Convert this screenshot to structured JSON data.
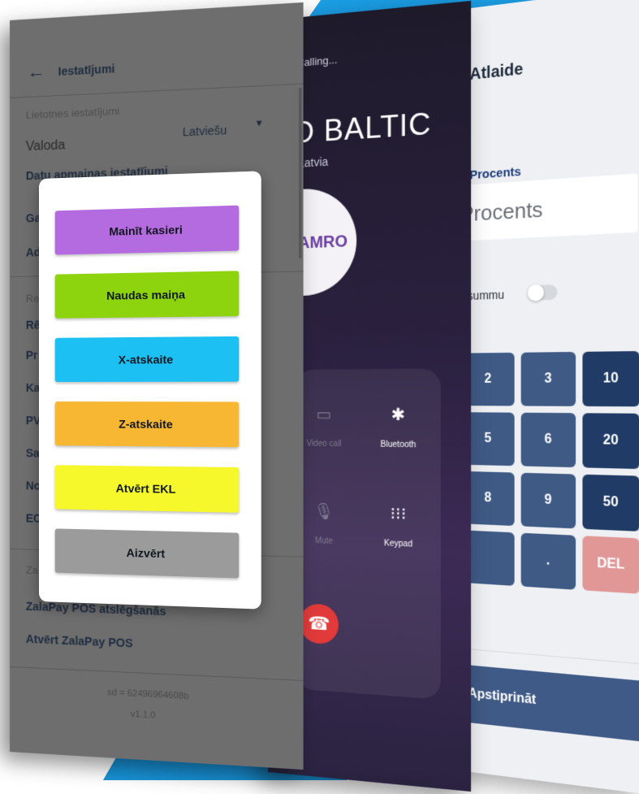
{
  "colors": {
    "accent_blue": "#1aa0e8",
    "btn_purple": "#b56be0",
    "btn_green": "#8ed40e",
    "btn_cyan": "#1cc0f2",
    "btn_orange": "#f8b733",
    "btn_yellow": "#f6f82b",
    "btn_gray": "#9b9b9b"
  },
  "settings": {
    "title": "Iestatījumi",
    "section_app": "Lietotnes iestatījumi",
    "language_label": "Valoda",
    "language_value": "Latviešu",
    "data_exchange": "Datu apmaiņas iestatījumi",
    "partial_items": [
      "Ga",
      "Ad",
      "Re",
      "Rē",
      "Pr",
      "Ka",
      "PV",
      "Sa",
      "No",
      "EC",
      "Za"
    ],
    "zalapay_disconnect": "ZalaPay POS atslēgšanās",
    "zalapay_open": "Atvērt ZalaPay POS",
    "sd": "sd = 62496964608b",
    "version": "v1.1.0"
  },
  "modal": {
    "buttons": [
      "Mainīt kasieri",
      "Naudas maiņa",
      "X-atskaite",
      "Z-atskaite",
      "Atvērt EKL",
      "Aizvērt"
    ]
  },
  "call": {
    "status": "Calling...",
    "name": "O BALTIC",
    "country": "Latvia",
    "avatar_text": "AMRO",
    "video_call": "Video call",
    "bluetooth": "Bluetooth",
    "mute": "Mute",
    "keypad": "Keypad"
  },
  "discount": {
    "title": "Atlaide",
    "percent_label": "Procents",
    "percent_placeholder": "Procents",
    "use_sum": "ıtot summu",
    "keys": [
      "2",
      "3",
      "10",
      "5",
      "6",
      "20",
      "8",
      "9",
      "50",
      "",
      ".",
      "DEL"
    ],
    "confirm": "Apstiprināt"
  }
}
